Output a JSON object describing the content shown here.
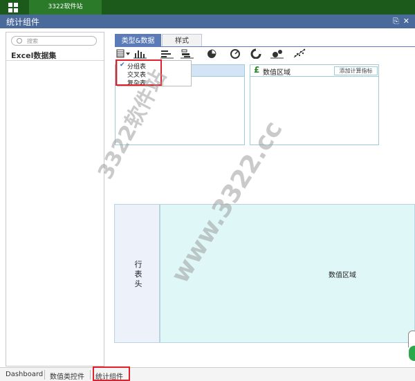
{
  "topbar": {
    "tab_label": "3322软件站"
  },
  "window": {
    "title": "统计组件"
  },
  "left_panel": {
    "search_placeholder": "搜索",
    "dataset_label": "Excel数据集"
  },
  "tabs": [
    {
      "label": "类型&数据",
      "active": true
    },
    {
      "label": "样式",
      "active": false
    }
  ],
  "toolbar_icons": [
    "table-icon",
    "bar-chart-icon",
    "horizontal-bar-icon",
    "stacked-bar-icon",
    "pie-chart-icon",
    "gauge-icon",
    "donut-icon",
    "bubble-icon",
    "scatter-icon"
  ],
  "dropdown": {
    "items": [
      "分组表",
      "交叉表",
      "复杂表"
    ],
    "selected": "分组表"
  },
  "value_box": {
    "label": "数值区域",
    "add_button": "添加计算指标"
  },
  "grid": {
    "row_header": [
      "行",
      "表",
      "头"
    ],
    "value_region": "数值区域"
  },
  "bottom_tabs": [
    {
      "label": "Dashboard"
    },
    {
      "label": "数值类控件"
    },
    {
      "label": "统计组件",
      "active": true
    }
  ],
  "watermark": [
    "3322软件站",
    "www.3322.cc"
  ],
  "colors": {
    "topbar": "#1c5a1c",
    "titlebar": "#4a6a9c",
    "active_tab": "#5a7ab8",
    "highlight": "#e0202a",
    "value_region": "#e0f7f8"
  }
}
